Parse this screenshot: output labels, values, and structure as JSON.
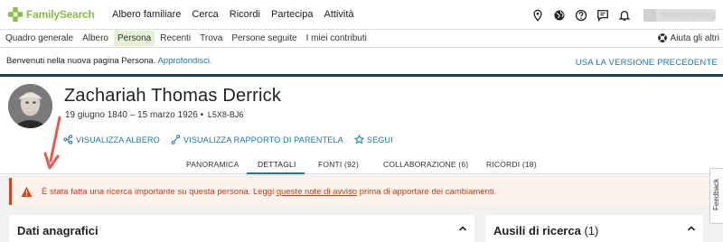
{
  "logo": {
    "text": "FamilySearch"
  },
  "main_nav": [
    "Albero familiare",
    "Cerca",
    "Ricordi",
    "Partecipa",
    "Attività"
  ],
  "top_icons": [
    "location-pin-icon",
    "globe-icon",
    "help-circle-icon",
    "chat-icon",
    "bell-icon"
  ],
  "user": {
    "name": "Stefano Monks"
  },
  "sub_nav": {
    "items": [
      "Quadro generale",
      "Albero",
      "Persona",
      "Recenti",
      "Trova",
      "Persone seguite",
      "I miei contributi"
    ],
    "active": "Persona",
    "help_label": "Aiuta gli altri"
  },
  "welcome": {
    "message": "Benvenuti nella nuova pagina Persona.",
    "link": "Approfondisci.",
    "old_version": "USA LA VERSIONE PRECEDENTE"
  },
  "person": {
    "name": "Zachariah Thomas Derrick",
    "dates": "19 giugno 1840 – 15 marzo 1926",
    "bullet": "•",
    "id": "L5X8-BJ6"
  },
  "actions": {
    "view_tree": "VISUALIZZA ALBERO",
    "view_relationship": "VISUALIZZA RAPPORTO DI PARENTELA",
    "follow": "SEGUI"
  },
  "tabs": [
    "PANORAMICA",
    "DETTAGLI",
    "FONTI (92)",
    "COLLABORAZIONE (6)",
    "RICORDI (18)"
  ],
  "active_tab": "DETTAGLI",
  "alert": {
    "before": "È stata fatta una ricerca importante su questa persona. Leggi",
    "link": "queste note di avviso",
    "after": "prima di apportare dei cambiamenti."
  },
  "cards": {
    "vitals_title": "Dati anagrafici",
    "research_title": "Ausili di ricerca",
    "research_count": "(1)"
  },
  "feedback": "Feedback",
  "colors": {
    "brand_green": "#8bbd46",
    "link_blue": "#1a79a3",
    "alert_red": "#c23f19",
    "header_navy": "#1f3f55"
  }
}
